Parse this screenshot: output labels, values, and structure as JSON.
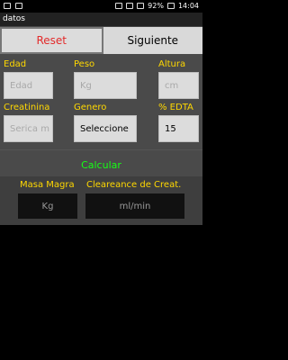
{
  "status_bar": {
    "battery": "92%",
    "time": "14:04"
  },
  "title": "datos",
  "top_buttons": {
    "reset": "Reset",
    "next": "Siguiente"
  },
  "fields": {
    "edad": {
      "label": "Edad",
      "placeholder": "Edad"
    },
    "peso": {
      "label": "Peso",
      "placeholder": "Kg"
    },
    "altura": {
      "label": "Altura",
      "placeholder": "cm"
    },
    "creatinina": {
      "label": "Creatinina",
      "placeholder": "Serica m"
    },
    "genero": {
      "label": "Genero",
      "value": "Seleccione"
    },
    "edta": {
      "label": "% EDTA",
      "value": "15"
    }
  },
  "calcular": "Calcular",
  "results": {
    "masa_magra": {
      "label": "Masa Magra",
      "unit": "Kg"
    },
    "clearance": {
      "label": "Cleareance de Creat.",
      "unit": "ml/min"
    }
  },
  "colors": {
    "label": "#ffd800",
    "calc": "#15ff15",
    "reset": "#e32b2b"
  }
}
